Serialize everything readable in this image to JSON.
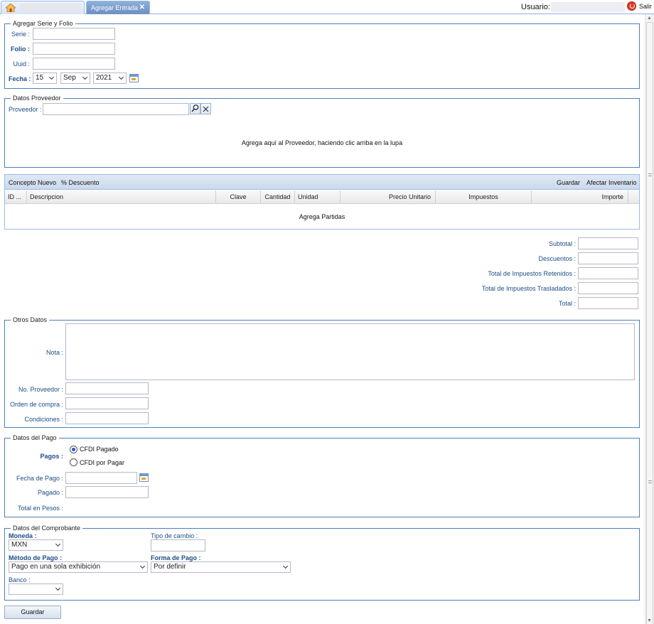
{
  "tabs": {
    "active_label": "Agregar Entrada",
    "close_glyph": "✕"
  },
  "header": {
    "user_label": "Usuario:",
    "logout_label": "Salir"
  },
  "serie_folio": {
    "legend": "Agregar Serie y Folio",
    "serie_label": "Serie :",
    "folio_label": "Folio :",
    "uuid_label": "Uuid :",
    "fecha_label": "Fecha :",
    "day": "15",
    "month": "Sep",
    "year": "2021"
  },
  "proveedor": {
    "legend": "Datos Proveedor",
    "label": "Proveedor :",
    "hint": "Agrega aquí al Proveedor, haciendo clic arriba en la lupa"
  },
  "grid": {
    "toolbar": {
      "concepto": "Concepto Nuevo",
      "descuento": "% Descuento",
      "guardar": "Guardar",
      "afectar": "Afectar Inventario"
    },
    "columns": [
      "ID ...",
      "Descripcion",
      "Clave",
      "Cantidad",
      "Unidad",
      "Precio Unitario",
      "Impuestos",
      "Importe"
    ],
    "empty_text": "Agrega Partidas"
  },
  "totals": {
    "subtotal": "Subtotal :",
    "descuentos": "Descuentos :",
    "retenidos": "Total de Impuestos Retenidos :",
    "trasladados": "Total de Impuestos Trasladados :",
    "total": "Total :"
  },
  "otros": {
    "legend": "Otros Datos",
    "nota": "Nota :",
    "no_proveedor": "No. Proveedor :",
    "orden_compra": "Orden de compra :",
    "condiciones": "Condiciones :"
  },
  "pago": {
    "legend": "Datos del Pago",
    "pagos_label": "Pagos :",
    "opt_pagado": "CFDI Pagado",
    "opt_por_pagar": "CFDI por Pagar",
    "fecha_pago": "Fecha de Pago :",
    "pagado": "Pagado :",
    "total_pesos": "Total en Pesos :"
  },
  "comprobante": {
    "legend": "Datos del Comprobante",
    "moneda_label": "Moneda :",
    "moneda_value": "MXN",
    "tipo_cambio_label": "Tipo de cambio :",
    "metodo_label": "Método de Pago :",
    "metodo_value": "Pago en una sola exhibición",
    "forma_label": "Forma de Pago :",
    "forma_value": "Por definir",
    "banco_label": "Banco :",
    "banco_value": ""
  },
  "footer": {
    "save_label": "Guardar"
  },
  "icons": [
    "home-icon",
    "close-icon",
    "logout-icon",
    "calendar-icon",
    "search-icon",
    "clear-icon",
    "chevron-down-icon"
  ]
}
